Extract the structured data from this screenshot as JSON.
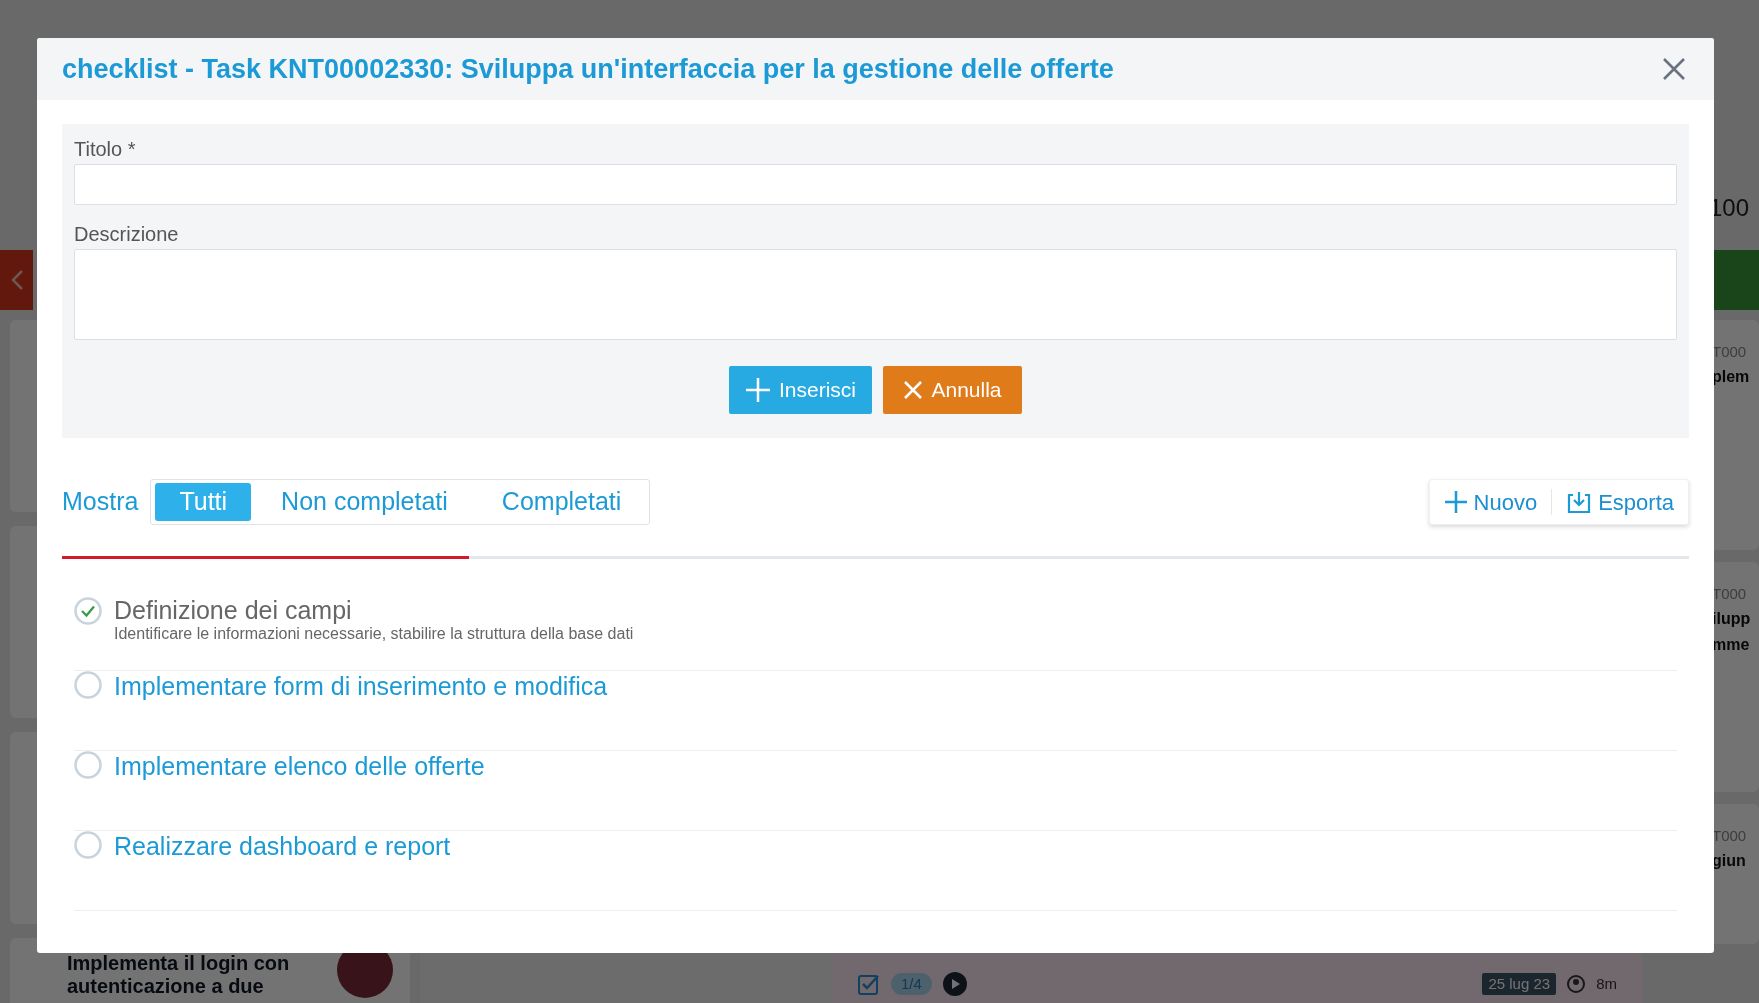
{
  "background": {
    "board_value": "100",
    "right_cards": [
      {
        "code": "T000",
        "title_lines": [
          "plem"
        ]
      },
      {
        "code": "T000",
        "title_lines": [
          "ilupp",
          "mme"
        ]
      },
      {
        "code": "T000",
        "title_lines": [
          "giun"
        ]
      }
    ],
    "bottom_card": {
      "title": "Implementa il login con autenticazione a due"
    },
    "task_footer": {
      "checklist_count": "1/4",
      "date": "25 lug 23",
      "time": "8m"
    }
  },
  "dialog": {
    "title": "checklist - Task KNT00002330: Sviluppa un'interfaccia per la gestione delle offerte",
    "form": {
      "fields": [
        {
          "label": "Titolo *",
          "kind": "input"
        },
        {
          "label": "Descrizione",
          "kind": "textarea"
        }
      ],
      "buttons": [
        {
          "label": "Inserisci",
          "kind": "primary"
        },
        {
          "label": "Annulla",
          "kind": "cancel"
        }
      ]
    },
    "filter": {
      "label": "Mostra",
      "tabs": [
        {
          "label": "Tutti",
          "selected": true
        },
        {
          "label": "Non completati",
          "selected": false
        },
        {
          "label": "Completati",
          "selected": false
        }
      ]
    },
    "actions": [
      {
        "label": "Nuovo",
        "kind": "new"
      },
      {
        "label": "Esporta",
        "kind": "export"
      }
    ],
    "progress": {
      "level": 0.25
    },
    "items": [
      {
        "title": "Definizione dei campi",
        "description": "Identificare le informazioni necessarie, stabilire la struttura della base dati",
        "checked": true
      },
      {
        "title": "Implementare form di inserimento e modifica",
        "checked": false
      },
      {
        "title": "Implementare elenco delle offerte",
        "checked": false
      },
      {
        "title": "Realizzare dashboard e report",
        "checked": false
      }
    ]
  }
}
